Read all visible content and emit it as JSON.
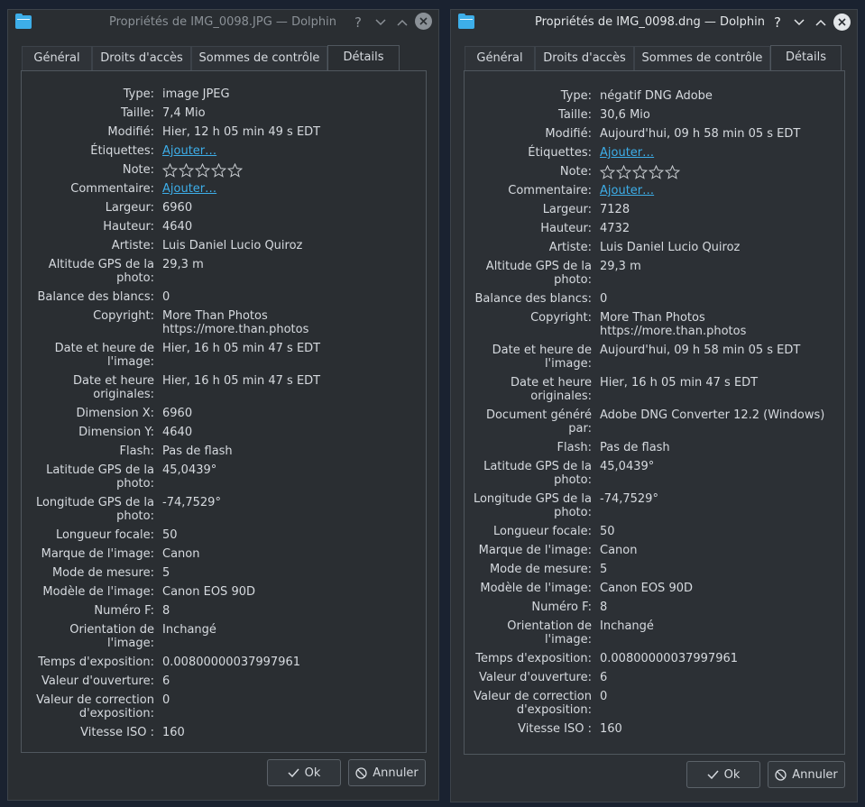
{
  "windows": [
    {
      "title": "Propriétés de IMG_0098.JPG — Dolphin",
      "tabs": [
        "Général",
        "Droits d'accès",
        "Sommes de contrôle",
        "Détails"
      ],
      "active_tab": "Détails",
      "rows": [
        {
          "label": "Type:",
          "value": "image JPEG"
        },
        {
          "label": "Taille:",
          "value": "7,4 Mio"
        },
        {
          "label": "Modifié:",
          "value": "Hier, 12 h 05 min 49 s EDT"
        },
        {
          "label": "Étiquettes:",
          "value": "Ajouter…"
        },
        {
          "label": "Note:",
          "value": ""
        },
        {
          "label": "Commentaire:",
          "value": "Ajouter…"
        },
        {
          "label": "Largeur:",
          "value": "6960"
        },
        {
          "label": "Hauteur:",
          "value": "4640"
        },
        {
          "label": "Artiste:",
          "value": "Luis Daniel Lucio Quiroz"
        },
        {
          "label": "Altitude GPS de la\nphoto:",
          "value": "29,3 m"
        },
        {
          "label": "Balance des blancs:",
          "value": "0"
        },
        {
          "label": "Copyright:",
          "value": "More Than Photos\nhttps://more.than.photos"
        },
        {
          "label": "Date et heure de\nl'image:",
          "value": "Hier, 16 h 05 min 47 s EDT"
        },
        {
          "label": "Date et heure\noriginales:",
          "value": "Hier, 16 h 05 min 47 s EDT"
        },
        {
          "label": "Dimension X:",
          "value": "6960"
        },
        {
          "label": "Dimension Y:",
          "value": "4640"
        },
        {
          "label": "Flash:",
          "value": "Pas de flash"
        },
        {
          "label": "Latitude GPS de la\nphoto:",
          "value": "45,0439°"
        },
        {
          "label": "Longitude GPS de la\nphoto:",
          "value": "-74,7529°"
        },
        {
          "label": "Longueur focale:",
          "value": "50"
        },
        {
          "label": "Marque de l'image:",
          "value": "Canon"
        },
        {
          "label": "Mode de mesure:",
          "value": "5"
        },
        {
          "label": "Modèle de l'image:",
          "value": "Canon EOS 90D"
        },
        {
          "label": "Numéro F:",
          "value": "8"
        },
        {
          "label": "Orientation de\nl'image:",
          "value": "Inchangé"
        },
        {
          "label": "Temps d'exposition:",
          "value": "0.00800000037997961"
        },
        {
          "label": "Valeur d'ouverture:",
          "value": "6"
        },
        {
          "label": "Valeur de correction\nd'exposition:",
          "value": "0"
        },
        {
          "label": "Vitesse ISO :",
          "value": "160"
        }
      ],
      "ok_label": "Ok",
      "cancel_label": "Annuler"
    },
    {
      "title": "Propriétés de IMG_0098.dng — Dolphin",
      "tabs": [
        "Général",
        "Droits d'accès",
        "Sommes de contrôle",
        "Détails"
      ],
      "active_tab": "Détails",
      "rows": [
        {
          "label": "Type:",
          "value": "négatif DNG Adobe"
        },
        {
          "label": "Taille:",
          "value": "30,6 Mio"
        },
        {
          "label": "Modifié:",
          "value": "Aujourd'hui, 09 h 58 min 05 s EDT"
        },
        {
          "label": "Étiquettes:",
          "value": "Ajouter…"
        },
        {
          "label": "Note:",
          "value": ""
        },
        {
          "label": "Commentaire:",
          "value": "Ajouter…"
        },
        {
          "label": "Largeur:",
          "value": "7128"
        },
        {
          "label": "Hauteur:",
          "value": "4732"
        },
        {
          "label": "Artiste:",
          "value": "Luis Daniel Lucio Quiroz"
        },
        {
          "label": "Altitude GPS de la\nphoto:",
          "value": "29,3 m"
        },
        {
          "label": "Balance des blancs:",
          "value": "0"
        },
        {
          "label": "Copyright:",
          "value": "More Than Photos\nhttps://more.than.photos"
        },
        {
          "label": "Date et heure de\nl'image:",
          "value": "Aujourd'hui, 09 h 58 min 05 s EDT"
        },
        {
          "label": "Date et heure\noriginales:",
          "value": "Hier, 16 h 05 min 47 s EDT"
        },
        {
          "label": "Document généré\npar:",
          "value": "Adobe DNG Converter 12.2 (Windows)"
        },
        {
          "label": "Flash:",
          "value": "Pas de flash"
        },
        {
          "label": "Latitude GPS de la\nphoto:",
          "value": "45,0439°"
        },
        {
          "label": "Longitude GPS de la\nphoto:",
          "value": "-74,7529°"
        },
        {
          "label": "Longueur focale:",
          "value": "50"
        },
        {
          "label": "Marque de l'image:",
          "value": "Canon"
        },
        {
          "label": "Mode de mesure:",
          "value": "5"
        },
        {
          "label": "Modèle de l'image:",
          "value": "Canon EOS 90D"
        },
        {
          "label": "Numéro F:",
          "value": "8"
        },
        {
          "label": "Orientation de\nl'image:",
          "value": "Inchangé"
        },
        {
          "label": "Temps d'exposition:",
          "value": "0.00800000037997961"
        },
        {
          "label": "Valeur d'ouverture:",
          "value": "6"
        },
        {
          "label": "Valeur de correction\nd'exposition:",
          "value": "0"
        },
        {
          "label": "Vitesse ISO :",
          "value": "160"
        }
      ],
      "ok_label": "Ok",
      "cancel_label": "Annuler"
    }
  ],
  "colors": {
    "link": "#3daee9",
    "accent": "#3daee9"
  }
}
